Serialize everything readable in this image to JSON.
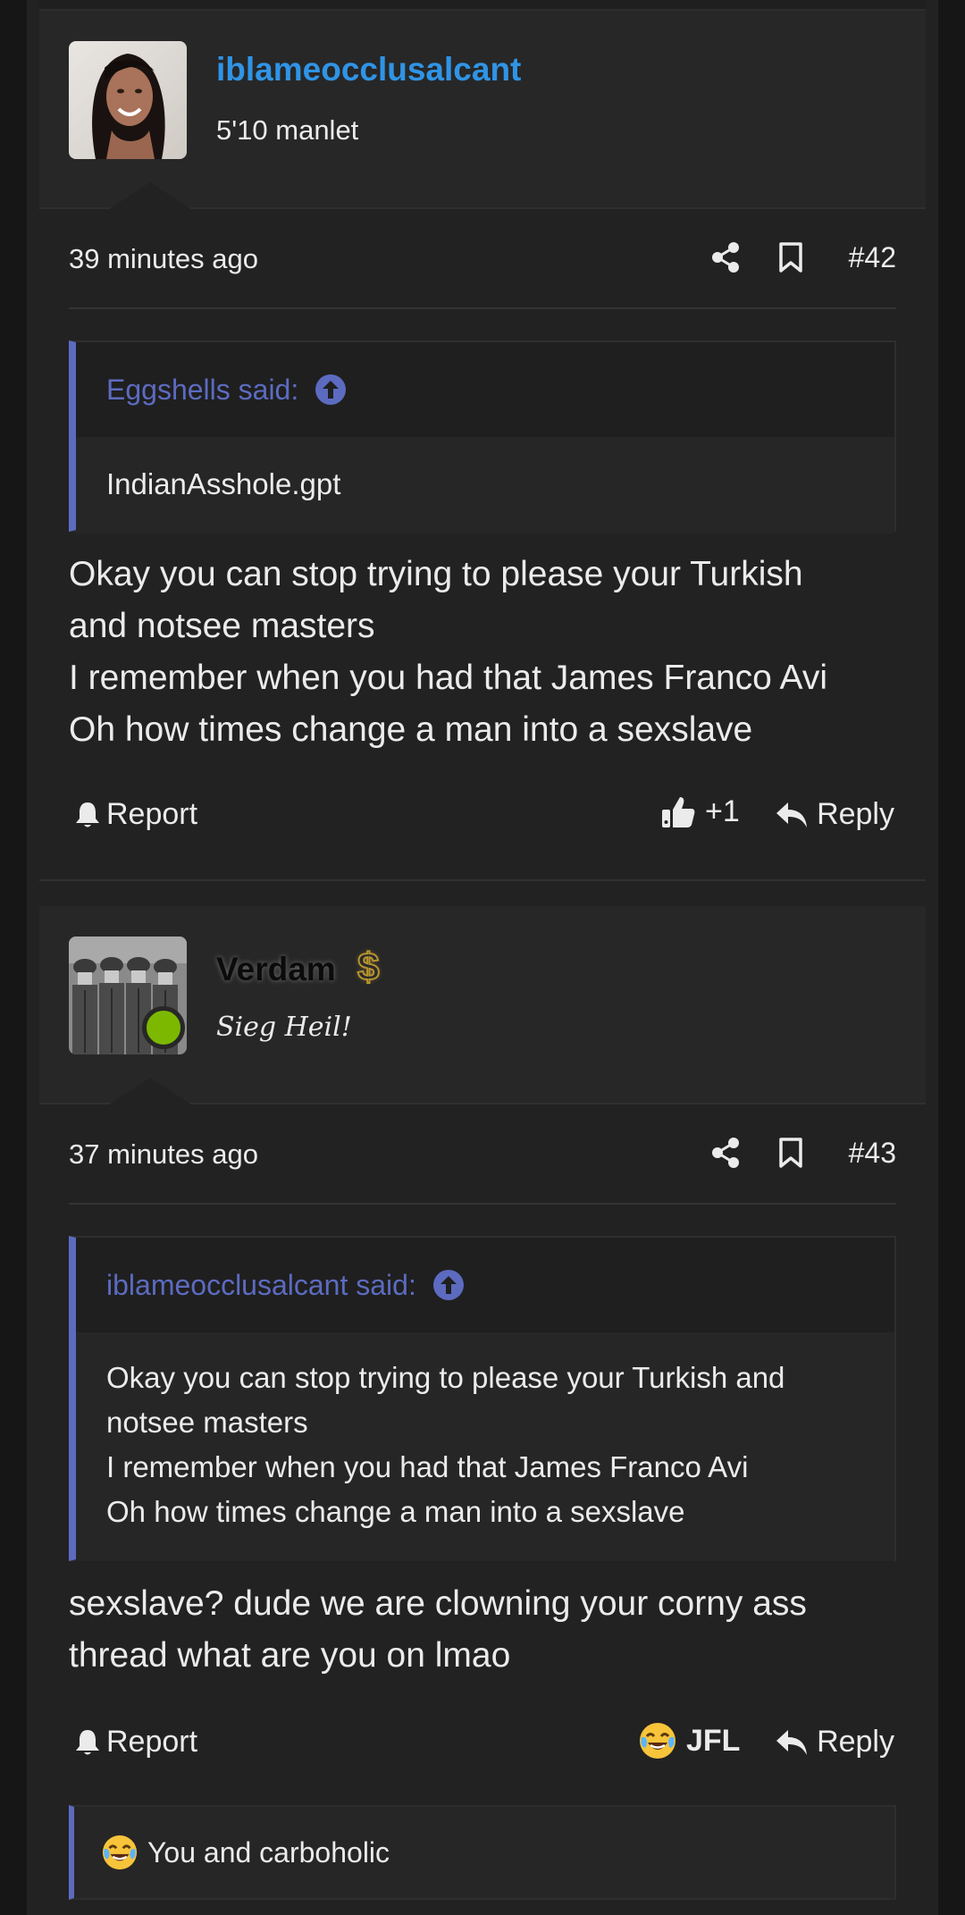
{
  "posts": [
    {
      "username": "iblameocclusalcant",
      "user_title": "5'10 manlet",
      "time": "39 minutes ago",
      "post_number": "#42",
      "quote": {
        "author": "Eggshells said:",
        "text": "IndianAsshole.gpt"
      },
      "message_lines": [
        "Okay you can stop trying to please your Turkish",
        "and notsee masters",
        "I remember when you had that James Franco Avi",
        "Oh how times change a man into a sexslave"
      ],
      "report_label": "Report",
      "reaction_label": "+1",
      "reply_label": "Reply"
    },
    {
      "username": "Verdam",
      "username_badge": "$",
      "user_title": "Sieg Heil!",
      "time": "37 minutes ago",
      "post_number": "#43",
      "quote": {
        "author": "iblameocclusalcant said:",
        "lines": [
          "Okay you can stop trying to please your Turkish and",
          "notsee masters",
          "I remember when you had that James Franco Avi",
          "Oh how times change a man into a sexslave"
        ]
      },
      "message_lines": [
        "sexslave? dude we are clowning your corny ass",
        "thread what are you on lmao"
      ],
      "report_label": "Report",
      "reaction_label": "JFL",
      "reply_label": "Reply",
      "reactions_bar": "You and carboholic"
    }
  ],
  "colors": {
    "username_blue": "#2f94e6",
    "quote_accent": "#5c6bc0",
    "online_green": "#7cb800"
  },
  "icons": [
    "share-icon",
    "bookmark-icon",
    "arrow-up-circle-icon",
    "bell-icon",
    "thumbs-up-icon",
    "reply-arrow-icon",
    "crying-laughing-emoji-icon"
  ]
}
